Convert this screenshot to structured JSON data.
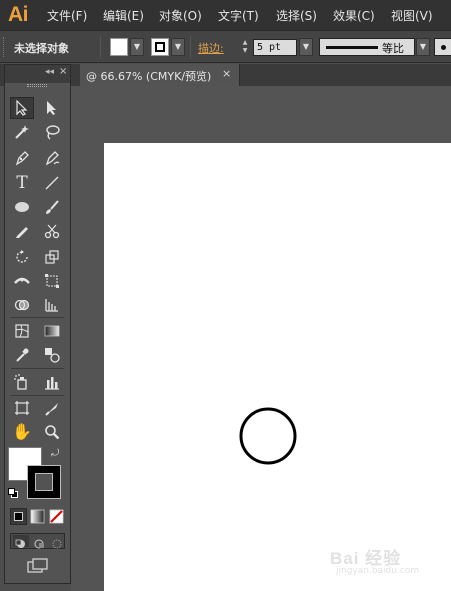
{
  "app": {
    "logo": "Ai"
  },
  "menu": [
    "文件(F)",
    "编辑(E)",
    "对象(O)",
    "文字(T)",
    "选择(S)",
    "效果(C)",
    "视图(V)"
  ],
  "control": {
    "selection_status": "未选择对象",
    "stroke_label": "描边",
    "stroke_colon": ":",
    "stroke_width": "5 pt",
    "profile_label": "等比",
    "fill_color": "#ffffff",
    "stroke_color": "#000000"
  },
  "document": {
    "tab_label": "@ 66.67% (CMYK/预览)",
    "tab_close": "×"
  },
  "toolbox": {
    "collapse": "◂◂",
    "close": "×",
    "fill_color": "#ffffff",
    "stroke_color": "#000000"
  },
  "watermark": {
    "text": "Bai 经验",
    "url": "jingyan.baidu.com"
  },
  "colors": {
    "accent": "#f0a03b",
    "stroke_label": "#e2a04a",
    "artboard": "#ffffff",
    "workspace": "#545454"
  }
}
